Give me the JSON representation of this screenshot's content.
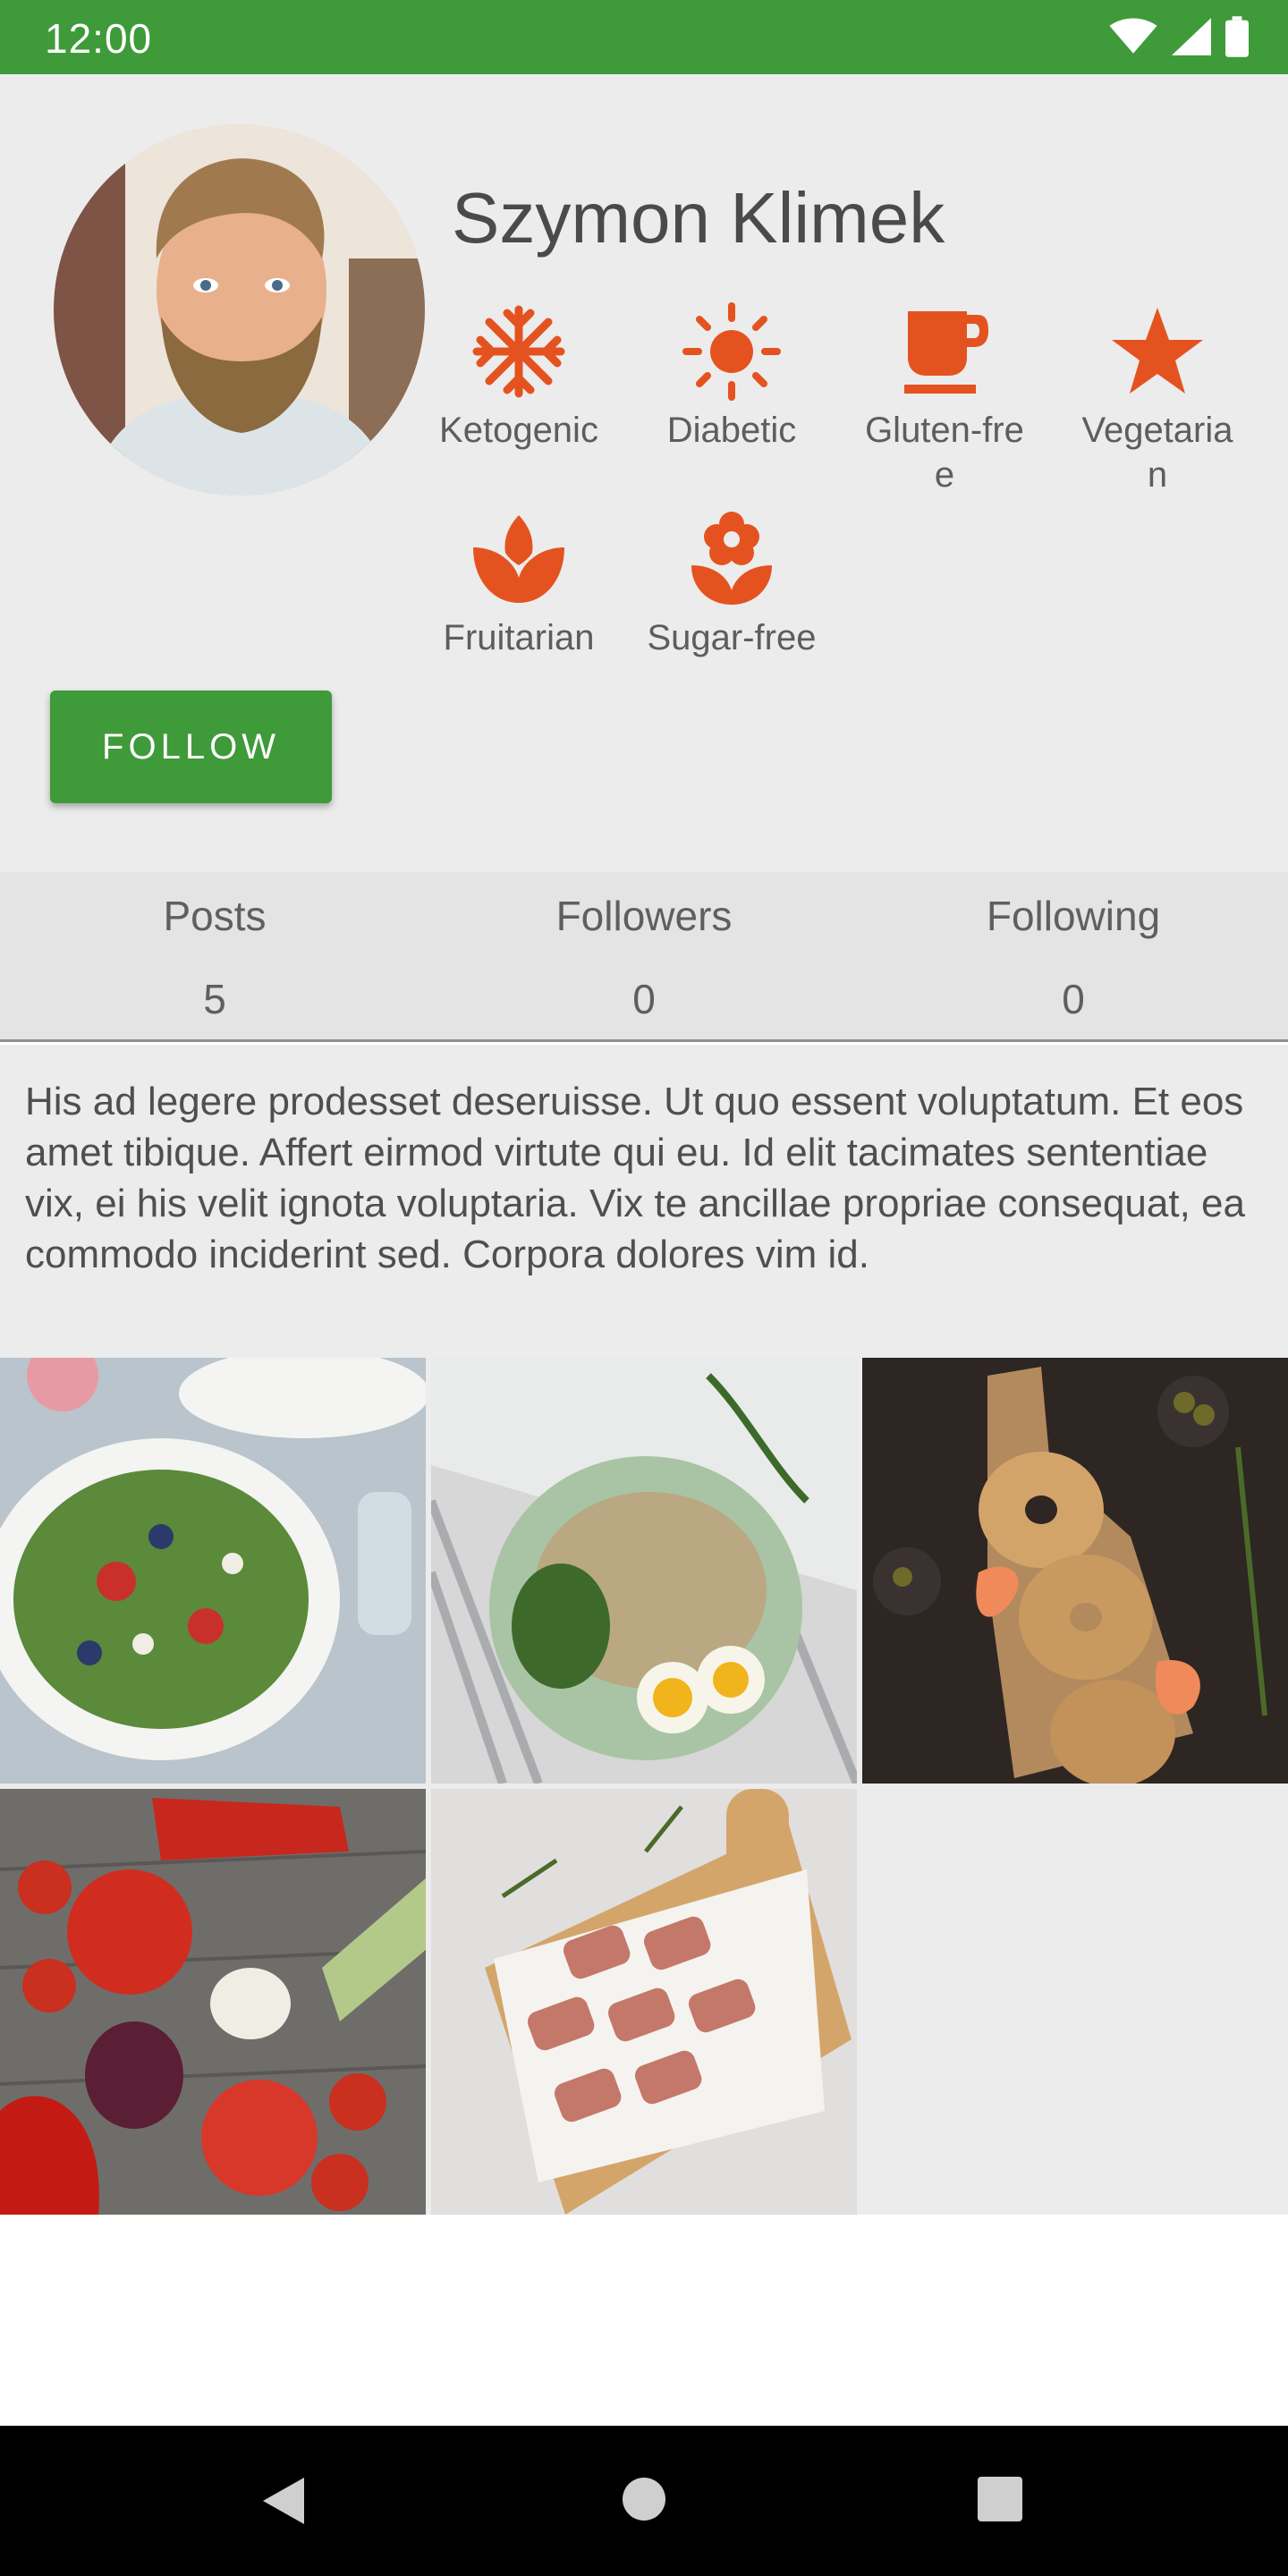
{
  "status_bar": {
    "time": "12:00",
    "icons": [
      "wifi-icon",
      "signal-icon",
      "battery-icon"
    ],
    "color": "#3f9a3a"
  },
  "profile": {
    "name": "Szymon Klimek",
    "avatar": "profile-photo",
    "diets": [
      {
        "label": "Ketogenic",
        "icon": "snowflake-icon"
      },
      {
        "label": "Diabetic",
        "icon": "sun-icon"
      },
      {
        "label": "Gluten-free",
        "line1": "Gluten-fre",
        "line2": "e",
        "icon": "cup-icon"
      },
      {
        "label": "Vegetarian",
        "line1": "Vegetaria",
        "line2": "n",
        "icon": "star-icon"
      },
      {
        "label": "Fruitarian",
        "icon": "leaf-icon"
      },
      {
        "label": "Sugar-free",
        "icon": "flower-icon"
      }
    ],
    "icon_color": "#e4531f",
    "follow_label": "FOLLOW"
  },
  "stats": [
    {
      "label": "Posts",
      "value": "5"
    },
    {
      "label": "Followers",
      "value": "0"
    },
    {
      "label": "Following",
      "value": "0"
    }
  ],
  "bio": "His ad legere prodesset deseruisse. Ut quo essent voluptatum. Et eos amet tibique. Affert eirmod virtute qui eu. Id elit tacimates sententiae vix, ei his velit ignota voluptaria. Vix te ancillae propriae consequat, ea commodo inciderint sed. Corpora dolores vim id.",
  "posts": [
    {
      "image": "salad-photo"
    },
    {
      "image": "rice-egg-plate-photo"
    },
    {
      "image": "bagels-salmon-photo"
    },
    {
      "image": "vegetables-photo"
    },
    {
      "image": "bacon-rolls-photo"
    }
  ],
  "nav": {
    "buttons": [
      "back-icon",
      "home-icon",
      "recents-icon"
    ]
  }
}
